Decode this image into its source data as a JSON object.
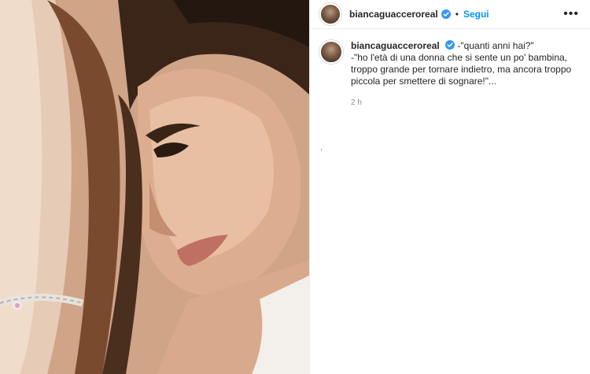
{
  "post": {
    "account": {
      "username": "biancaguacceroreal",
      "verified": true,
      "follow_label": "Segui",
      "separator": "•",
      "more_label": "•••"
    },
    "caption": {
      "line1": "-\"quanti anni hai?\"",
      "line2": "-\"ho l'età di una donna che si sente un po' bambina, troppo grande per tornare indietro, ma ancora troppo piccola per smettere di sognare!\"..."
    },
    "timestamp": "2 h",
    "stray_mark": "ʳ"
  },
  "colors": {
    "link_blue": "#0095f6",
    "verified_blue": "#3897f0",
    "text": "#262626",
    "muted": "#8e8e8e"
  },
  "icons": [
    "verified-badge-icon",
    "more-options-icon"
  ]
}
